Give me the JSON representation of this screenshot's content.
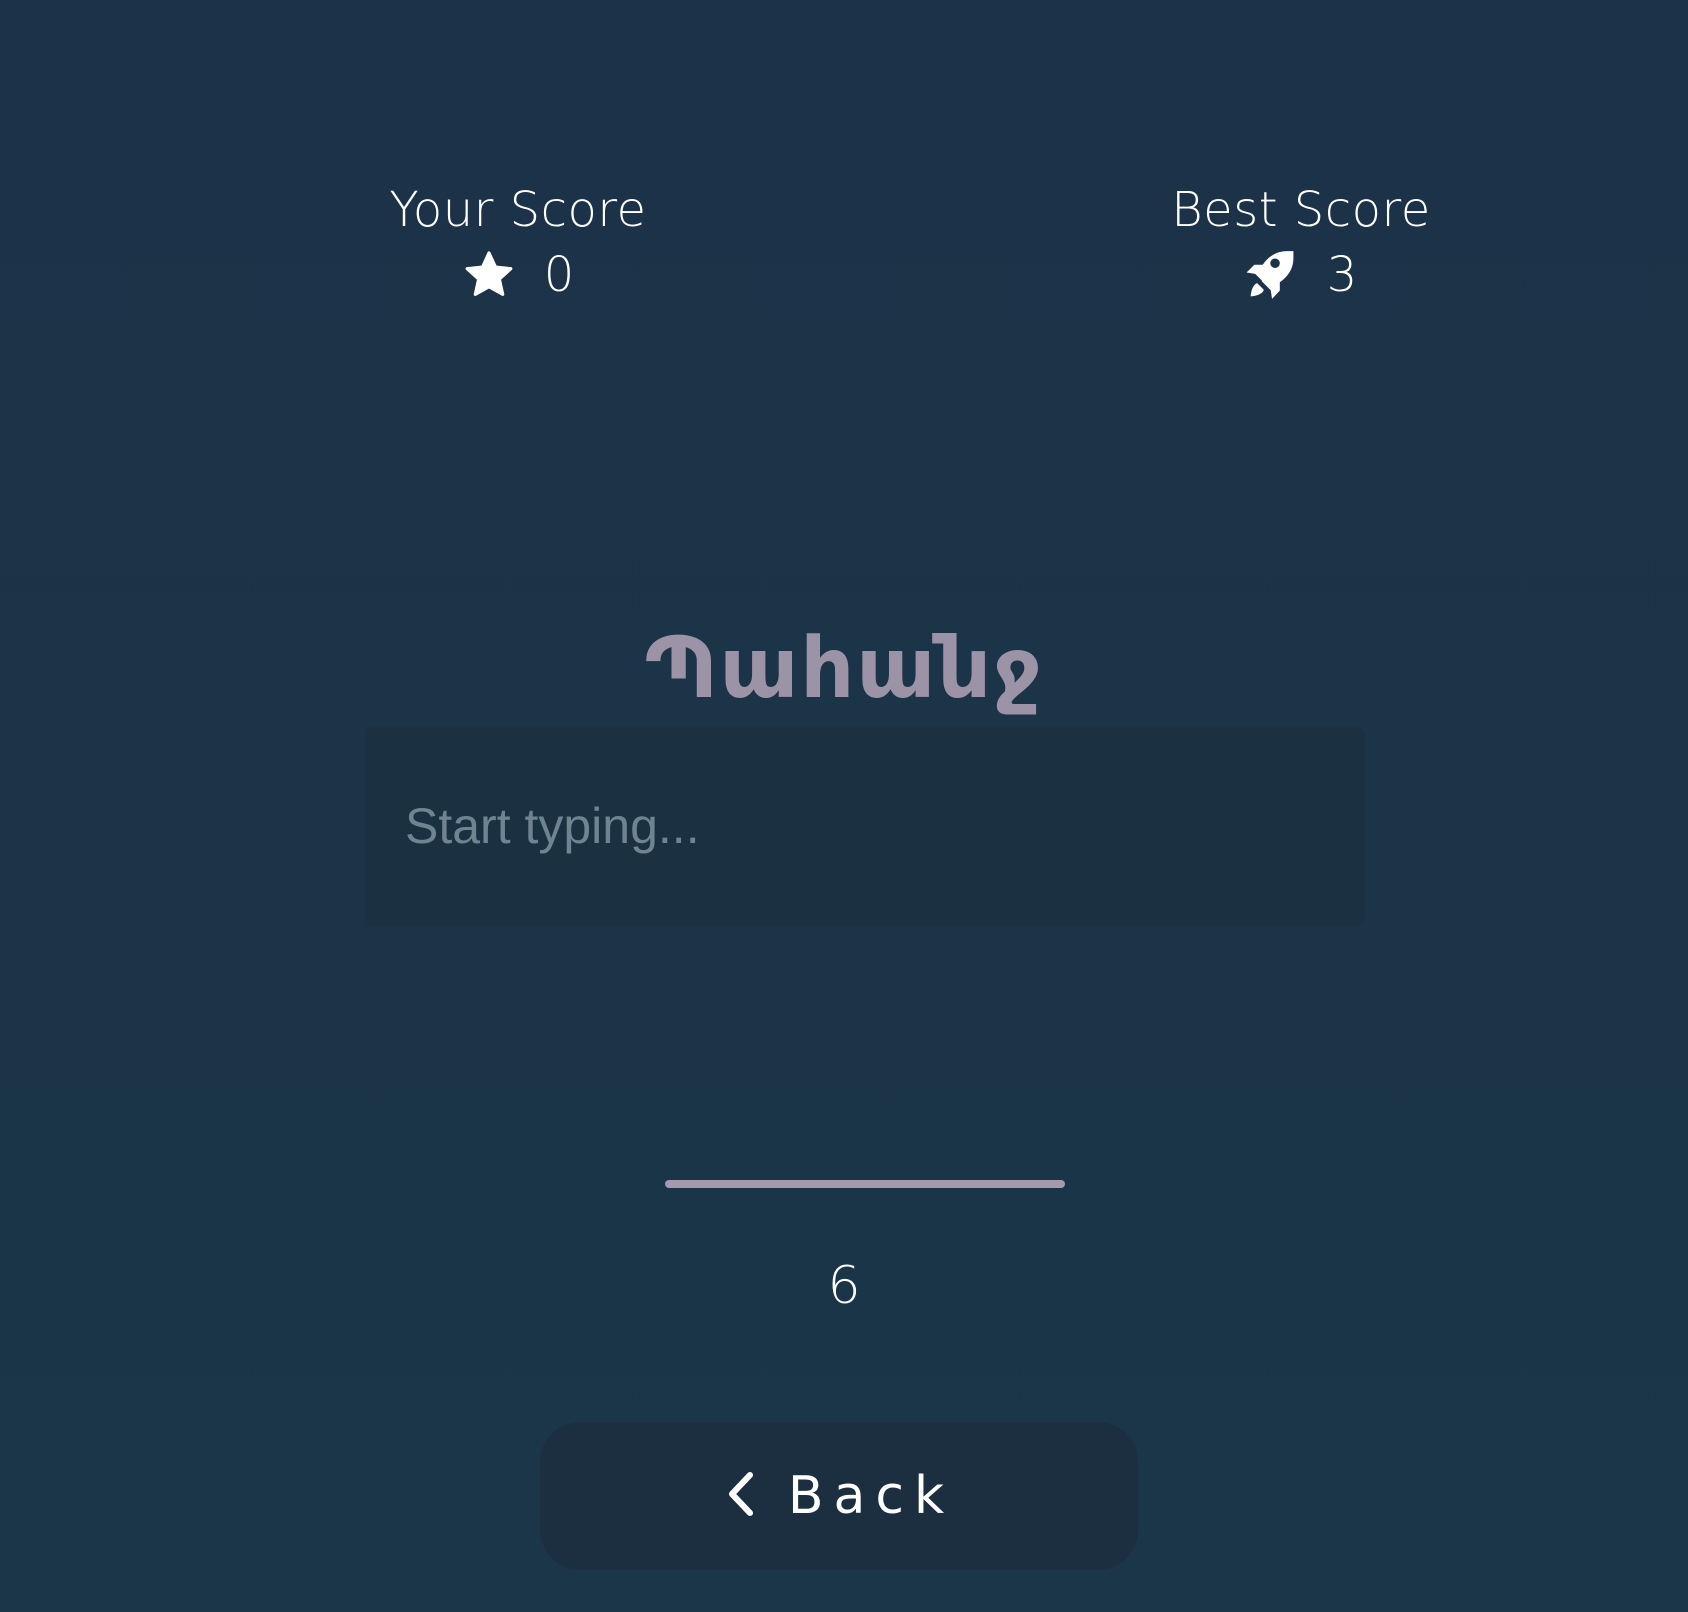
{
  "scores": {
    "your_label": "Your Score",
    "your_value": "0",
    "your_icon": "star-icon",
    "best_label": "Best Score",
    "best_value": "3",
    "best_icon": "rocket-icon"
  },
  "game": {
    "target_word": "Պահանջ",
    "input_placeholder": "Start typing...",
    "input_value": "",
    "timer_fraction": 1.0,
    "countdown": "6"
  },
  "nav": {
    "back_label": "Back",
    "back_icon": "chevron-left-icon"
  },
  "colors": {
    "background": "#1c3447",
    "word": "#9c93a6",
    "timer_bar": "#a59bad",
    "input_bg": "#1b3142",
    "button_bg": "#1b2f40"
  }
}
